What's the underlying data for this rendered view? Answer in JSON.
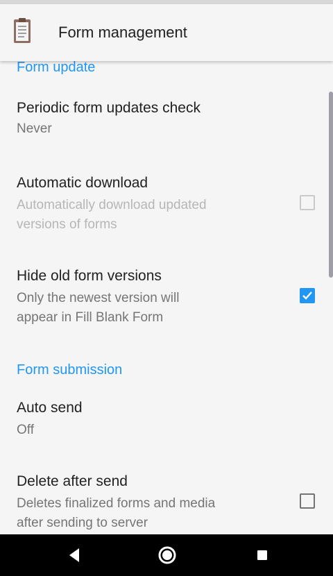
{
  "app_bar": {
    "title": "Form management",
    "icon": "clipboard-icon"
  },
  "sections": {
    "form_update": "Form update",
    "form_submission": "Form submission"
  },
  "prefs": {
    "periodic": {
      "title": "Periodic form updates check",
      "summary": "Never"
    },
    "auto_download": {
      "title": "Automatic download",
      "summary_line1": "Automatically download updated",
      "summary_line2": "versions of forms",
      "checked": false,
      "enabled": false
    },
    "hide_old": {
      "title": "Hide old form versions",
      "summary_line1": "Only the newest version will",
      "summary_line2": "appear in Fill Blank Form",
      "checked": true
    },
    "auto_send": {
      "title": "Auto send",
      "summary": "Off"
    },
    "delete_after_send": {
      "title": "Delete after send",
      "summary_line1": "Deletes finalized forms and media",
      "summary_line2": "after sending to server",
      "checked": false
    }
  },
  "nav_bar": {
    "back": "back-icon",
    "home": "home-icon",
    "recents": "recents-icon"
  },
  "colors": {
    "accent": "#2196f3",
    "background": "#f5f5f5",
    "nav_bar": "#000000"
  }
}
